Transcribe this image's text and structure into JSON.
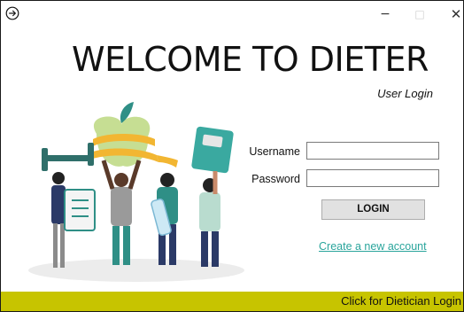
{
  "window": {
    "icons": {
      "back": "back-arrow-circle-icon",
      "minimize": "minimize-icon",
      "maximize": "maximize-icon",
      "close": "close-icon"
    },
    "minimize_glyph": "−",
    "maximize_glyph": "□",
    "close_glyph": "✕"
  },
  "header": {
    "title": "WELCOME TO DIETER",
    "subtitle": "User Login"
  },
  "form": {
    "username_label": "Username",
    "username_value": "",
    "password_label": "Password",
    "password_value": "",
    "login_label": "LOGIN",
    "create_account_link": "Create a new account"
  },
  "footer": {
    "dietician_link": "Click for Dietician Login"
  },
  "colors": {
    "footer_bar": "#c7c400",
    "link": "#2aa59c",
    "accent_teal": "#2f8f86",
    "apple_green": "#b5d37a",
    "tape_yellow": "#f2b632"
  }
}
